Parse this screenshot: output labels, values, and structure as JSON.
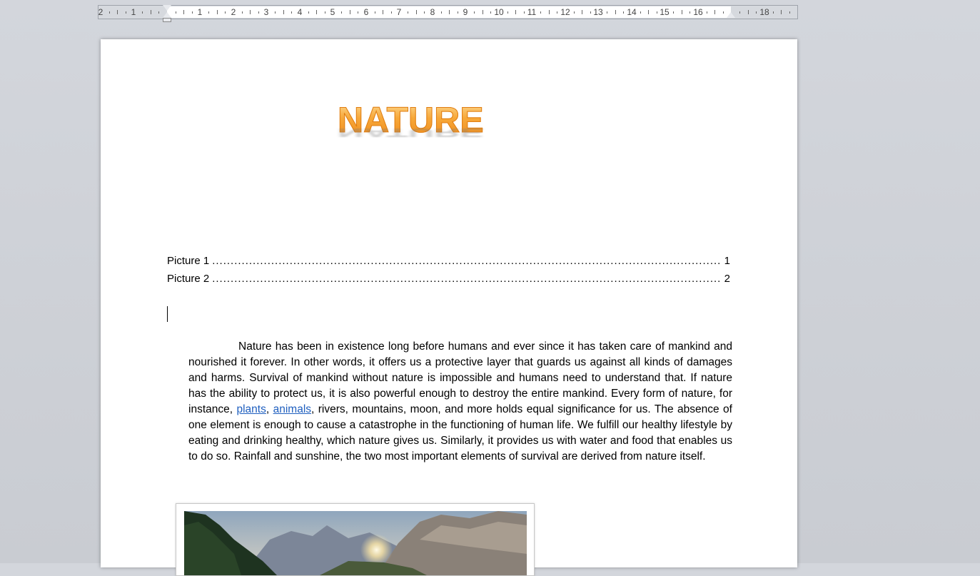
{
  "ruler": {
    "left_labels": [
      "2",
      "1"
    ],
    "right_labels": [
      "1",
      "2",
      "3",
      "4",
      "5",
      "6",
      "7",
      "8",
      "9",
      "10",
      "11",
      "12",
      "13",
      "14",
      "15",
      "16",
      "18"
    ]
  },
  "document": {
    "title": "NATURE",
    "toc": [
      {
        "label": "Picture 1",
        "page": "1"
      },
      {
        "label": "Picture 2",
        "page": "2"
      }
    ],
    "paragraph": {
      "part1": "Nature has been in existence long before humans and ever since it has taken care of mankind and nourished it forever. In other words, it offers us a protective layer that guards us against all kinds of damages and harms. Survival of mankind without nature is impossible and humans need to understand that. If nature has the ability to protect us, it is also powerful enough to destroy the entire mankind. Every form of nature, for instance, ",
      "link1": "plants",
      "sep": ", ",
      "link2": "animals",
      "part2": ", rivers, mountains, moon, and more holds equal significance for us. The absence of one element is enough to cause a catastrophe in the functioning of human life. We fulfill our healthy lifestyle by eating and drinking healthy, which nature gives us. Similarly, it provides us with water and food that enables us to do so. Rainfall and sunshine, the two most important elements of survival are derived from nature itself."
    }
  },
  "colors": {
    "title_orange": "#f5a32a",
    "link_blue": "#1f5fbf"
  }
}
